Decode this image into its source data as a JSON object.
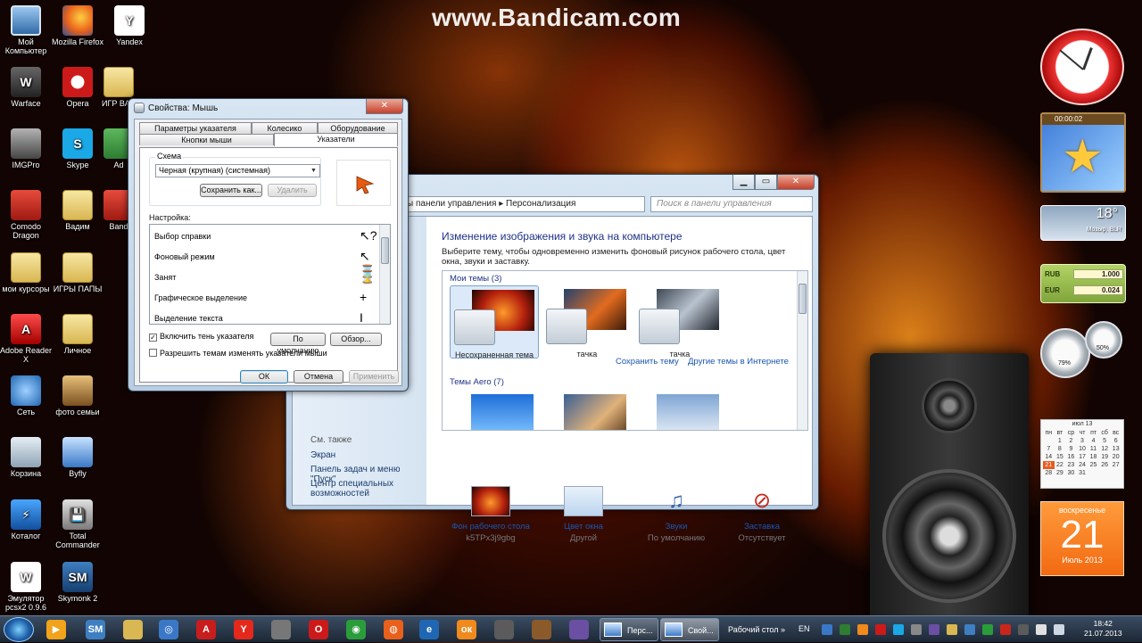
{
  "watermark": "www.Bandicam.com",
  "desktop": {
    "icons": [
      {
        "label": "Мой Компьютер",
        "icon": "computer-icon"
      },
      {
        "label": "Mozilla Firefox",
        "icon": "firefox-icon"
      },
      {
        "label": "Yandex",
        "icon": "yandex-icon"
      },
      {
        "label": "Warface",
        "icon": "warface-icon"
      },
      {
        "label": "Opera",
        "icon": "opera-icon"
      },
      {
        "label": "ИГР ВАД",
        "icon": "folder-icon"
      },
      {
        "label": "IMGPro",
        "icon": "imgpro-icon"
      },
      {
        "label": "Skype",
        "icon": "skype-icon"
      },
      {
        "label": "Ad",
        "icon": "app-icon"
      },
      {
        "label": "Comodo Dragon",
        "icon": "comodo-icon"
      },
      {
        "label": "Вадим",
        "icon": "folder-icon"
      },
      {
        "label": "Band",
        "icon": "bandicam-icon"
      },
      {
        "label": "мои курсоры",
        "icon": "folder-icon"
      },
      {
        "label": "ИГРЫ ПАПЫ",
        "icon": "folder-icon"
      },
      {
        "label": "Adobe Reader X",
        "icon": "adobe-reader-icon"
      },
      {
        "label": "Личное",
        "icon": "folder-icon"
      },
      {
        "label": "Сеть",
        "icon": "network-icon"
      },
      {
        "label": "фото семьи",
        "icon": "folder-icon"
      },
      {
        "label": "Корзина",
        "icon": "recycle-bin-icon"
      },
      {
        "label": "Byfly",
        "icon": "byfly-icon"
      },
      {
        "label": "Коталог",
        "icon": "catalog-icon"
      },
      {
        "label": "Total Commander",
        "icon": "total-commander-icon"
      },
      {
        "label": "Эмулятор pcsx2 0.9.6",
        "icon": "emulator-icon"
      },
      {
        "label": "Skymonk 2",
        "icon": "skymonk-icon"
      }
    ]
  },
  "personalization": {
    "address": "ы панели управления  ▸  Персонализация",
    "search_placeholder": "Поиск в панели управления",
    "heading": "Изменение изображения и звука на компьютере",
    "subtext": "Выберите тему, чтобы одновременно изменить фоновый рисунок рабочего стола, цвет окна, звуки и заставку.",
    "my_themes_label": "Мои темы (3)",
    "themes": [
      {
        "name": "Несохраненная тема",
        "selected": true
      },
      {
        "name": "тачка",
        "selected": false
      },
      {
        "name": "тачка",
        "selected": false
      }
    ],
    "save_theme_link": "Сохранить тему",
    "more_themes_link": "Другие темы в Интернете",
    "aero_label": "Темы Aero (7)",
    "see_also": "См. также",
    "left_links": [
      "Экран",
      "Панель задач и меню \"Пуск\"",
      "Центр специальных возможностей"
    ],
    "bottom": [
      {
        "label": "Фон рабочего стола",
        "value": "k5TPx3j9gbg",
        "icon": "desktop-background-icon"
      },
      {
        "label": "Цвет окна",
        "value": "Другой",
        "icon": "window-color-icon"
      },
      {
        "label": "Звуки",
        "value": "По умолчанию",
        "icon": "sounds-icon"
      },
      {
        "label": "Заставка",
        "value": "Отсутствует",
        "icon": "screensaver-icon"
      }
    ]
  },
  "mouse_dialog": {
    "title": "Свойства: Мышь",
    "tabs_top": [
      "Параметры указателя",
      "Колесико",
      "Оборудование"
    ],
    "tabs_bottom": [
      "Кнопки мыши",
      "Указатели"
    ],
    "active_tab": "Указатели",
    "scheme_label": "Схема",
    "scheme_value": "Черная (крупная) (системная)",
    "save_as_button": "Сохранить как...",
    "delete_button": "Удалить",
    "customize_label": "Настройка:",
    "pointer_rows": [
      {
        "label": "Выбор справки",
        "glyph": "↖?"
      },
      {
        "label": "Фоновый режим",
        "glyph": "↖⌛"
      },
      {
        "label": "Занят",
        "glyph": "⌛"
      },
      {
        "label": "Графическое выделение",
        "glyph": "+"
      },
      {
        "label": "Выделение текста",
        "glyph": "I"
      }
    ],
    "shadow_checkbox": "Включить тень указателя",
    "shadow_checked": true,
    "themes_checkbox": "Разрешить темам изменять указатели мыши",
    "themes_checked": false,
    "default_button": "По умолчанию",
    "browse_button": "Обзор...",
    "ok_button": "ОК",
    "cancel_button": "Отмена",
    "apply_button": "Применить"
  },
  "gadgets": {
    "puzzle_time": "00:00:02",
    "weather_temp": "18°",
    "weather_city": "Мозыр, BLR",
    "currency": [
      {
        "code": "RUB",
        "value": "1.000"
      },
      {
        "code": "EUR",
        "value": "0.024"
      }
    ],
    "meter_cpu": "79%",
    "meter_ram": "50%",
    "calendar_title": "июл 13",
    "calendar_days": [
      "пн",
      "вт",
      "ср",
      "чт",
      "пт",
      "сб",
      "вс",
      "",
      "1",
      "2",
      "3",
      "4",
      "5",
      "6",
      "7",
      "8",
      "9",
      "10",
      "11",
      "12",
      "13",
      "14",
      "15",
      "16",
      "17",
      "18",
      "19",
      "20",
      "21",
      "22",
      "23",
      "24",
      "25",
      "26",
      "27",
      "28",
      "29",
      "30",
      "31"
    ],
    "calendar_today": "21",
    "big_dow": "воскресенье",
    "big_day": "21",
    "big_month": "Июль 2013"
  },
  "taskbar": {
    "tasks": [
      {
        "label": "Перс..."
      },
      {
        "label": "Свой..."
      },
      {
        "label": "Рабочий стол"
      }
    ],
    "lang": "EN",
    "time": "18:42",
    "date": "21.07.2013"
  },
  "colors": {
    "link": "#1a56b3",
    "heading": "#1e3287",
    "calendar_today": "#e65c1f"
  }
}
